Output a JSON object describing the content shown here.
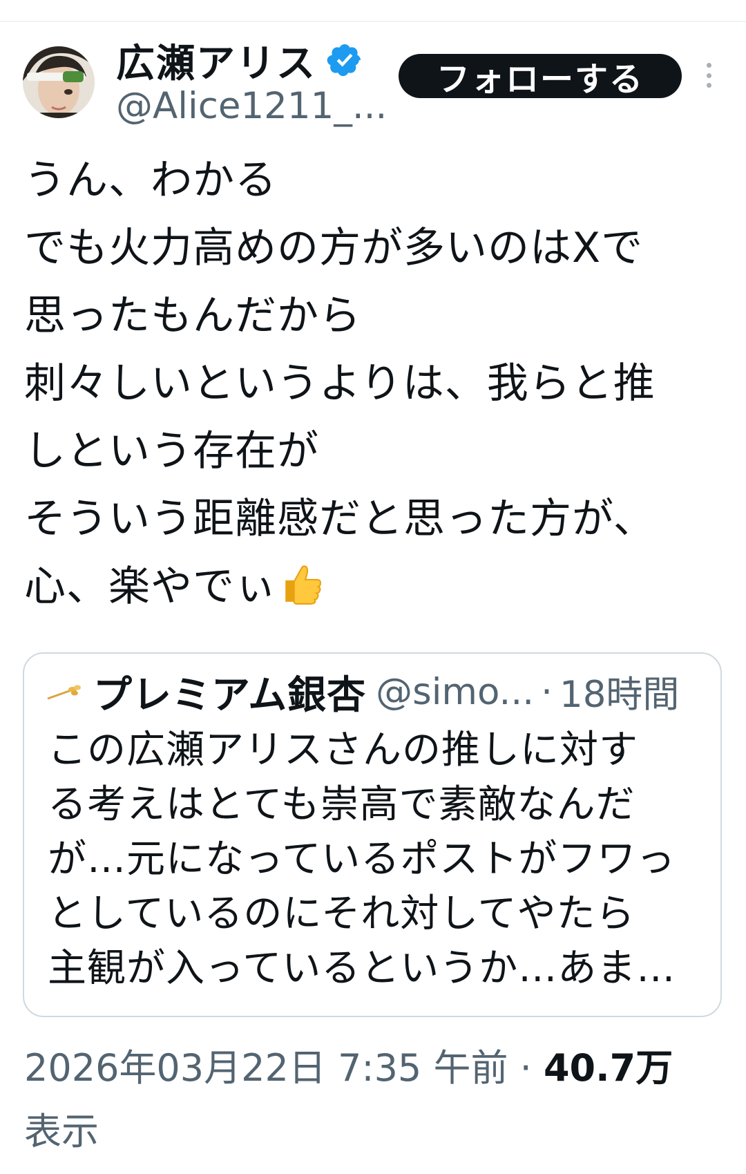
{
  "author": {
    "display_name": "広瀬アリス",
    "handle": "@Alice1211_...",
    "verified_icon": "verified-badge-icon",
    "follow_label": "フォローする",
    "more_icon": "more-vertical-icon"
  },
  "tweet": {
    "lines": [
      "うん、わかる",
      "でも火力高めの方が多いのはXで",
      "思ったもんだから",
      "刺々しいというよりは、我らと推",
      "しという存在が",
      "そういう距離感だと思った方が、",
      "心、楽やでぃ"
    ],
    "emoji": "thumbs-up-icon"
  },
  "quote": {
    "name": "プレミアム銀杏",
    "handle": "@simo...",
    "separator": "·",
    "time": "18時間",
    "lines": [
      "この広瀬アリスさんの推しに対す",
      "る考えはとても崇高で素敵なんだ",
      "が…元になっているポストがフワっ",
      "としているのにそれ対してやたら",
      "主観が入っているというか…あま…"
    ]
  },
  "meta": {
    "datetime": "2026年03月22日 7:35 午前",
    "separator": "·",
    "views_count": "40.7万",
    "views_label": "表示"
  },
  "colors": {
    "text": "#0f1419",
    "secondary": "#536471",
    "verified": "#1d9bf0",
    "border": "#cfd9de"
  }
}
